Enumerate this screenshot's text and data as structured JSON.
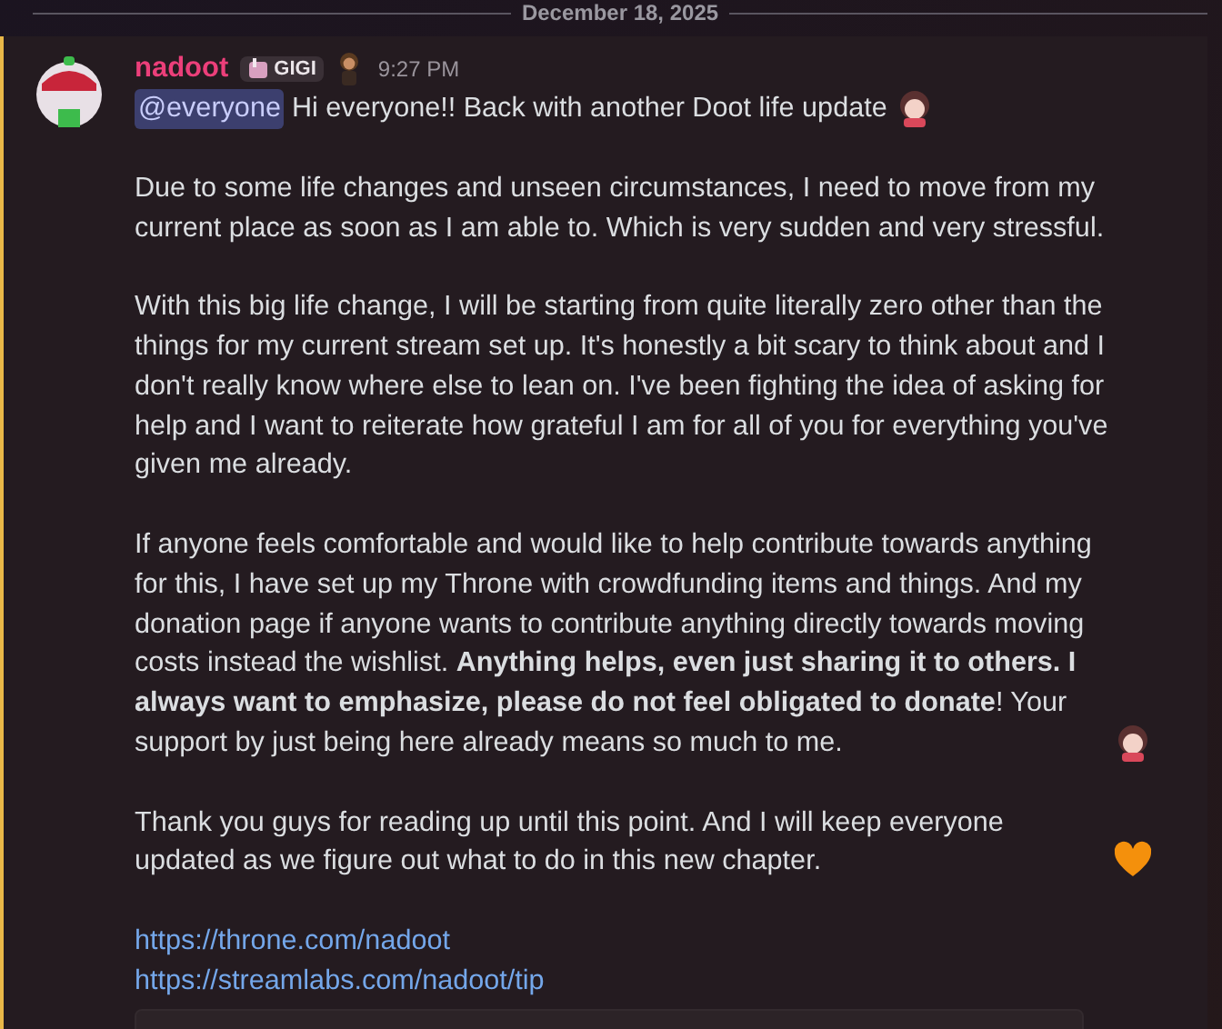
{
  "date_divider": "December 18, 2025",
  "message": {
    "author": "nadoot",
    "role_tag": "GIGI",
    "time": "9:27 PM",
    "mention": "@everyone",
    "paragraphs": [
      {
        "text": "Hi everyone!! Back with another Doot life update",
        "trailing_emoji": {
          "kind": "sticker"
        }
      },
      {
        "text": "Due to some life changes and unseen circumstances, I need to move from my current place as soon as I am able to. Which is very sudden and very stressful."
      },
      {
        "text": "With this big life change, I will be starting from quite literally zero other than the things for my current stream set up. It's honestly a bit scary to think about and I don't really know where else to lean on. I've been fighting the idea of asking for help and I want to reiterate how grateful I am for all of you for everything you've given me already."
      },
      {
        "text": "If anyone feels comfortable and would like to help contribute towards anything for this, I have set up my Throne with crowdfunding items and things. And my donation page if anyone wants to contribute anything directly towards moving costs instead the wishlist. **Anything helps, even just sharing it to others. I always want to emphasize, please do not feel obligated to donate**! Your support by just being here already means so much to me.",
        "trailing_emoji": {
          "kind": "sticker"
        }
      },
      {
        "text": "Thank you guys for reading up until this point. And I will keep everyone updated as we figure out what to do in this new chapter.",
        "trailing_emoji": {
          "kind": "heart"
        }
      }
    ],
    "links": [
      "https://throne.com/nadoot",
      "https://streamlabs.com/nadoot/tip"
    ],
    "embed": {
      "kind": "card"
    }
  }
}
